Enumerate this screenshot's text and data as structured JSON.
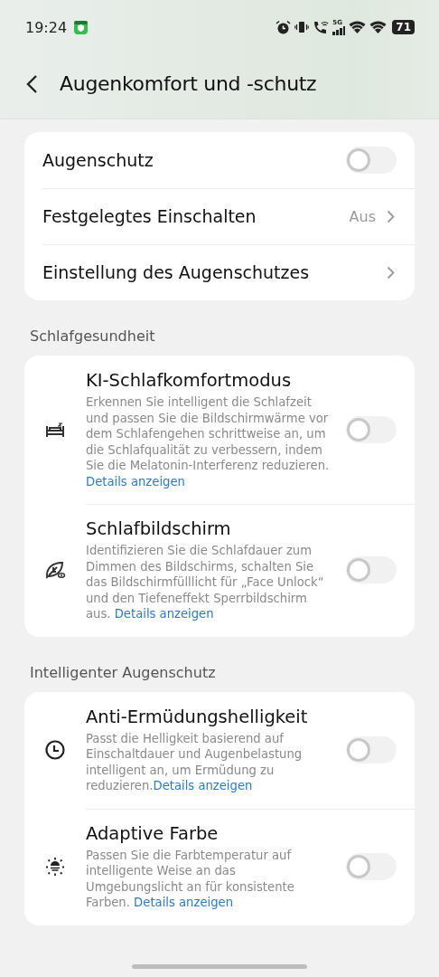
{
  "status_bar": {
    "time": "19:24",
    "network": "5G",
    "battery": "71"
  },
  "header": {
    "title": "Augenkomfort und -schutz"
  },
  "main_card": [
    {
      "kind": "toggle",
      "label": "Augenschutz",
      "on": false
    },
    {
      "kind": "link",
      "label": "Festgelegtes Einschalten",
      "value": "Aus"
    },
    {
      "kind": "link",
      "label": "Einstellung des Augenschutzes"
    }
  ],
  "sections": [
    {
      "title": "Schlafgesundheit",
      "items": [
        {
          "title": "KI-Schlafkomfortmodus",
          "description": "Erkennen Sie intelligent die Schlafzeit und passen Sie die Bildschirmwärme vor dem Schlafengehen schrittweise an, um die Schlafqualität zu verbessern, indem Sie die Melatonin-Interferenz reduzieren. ",
          "link": "Details anzeigen",
          "on": false
        },
        {
          "title": "Schlafbildschirm",
          "description": "Identifizieren Sie die Schlafdauer zum Dimmen des Bildschirms, schalten Sie das Bildschirmfülllicht für „Face Unlock“ und den Tiefeneffekt Sperrbildschirm aus. ",
          "link": "Details anzeigen",
          "on": false
        }
      ]
    },
    {
      "title": "Intelligenter Augenschutz",
      "items": [
        {
          "title": "Anti-Ermüdungshelligkeit",
          "description": "Passt die Helligkeit basierend auf Einschaltdauer und Augenbelastung intelligent an, um Ermüdung zu reduzieren.",
          "link": "Details anzeigen",
          "on": false
        },
        {
          "title": "Adaptive Farbe",
          "description": "Passen Sie die Farbtemperatur auf intelligente Weise an das Umgebungslicht an für konsistente Farben. ",
          "link": "Details anzeigen",
          "on": false
        }
      ]
    }
  ]
}
